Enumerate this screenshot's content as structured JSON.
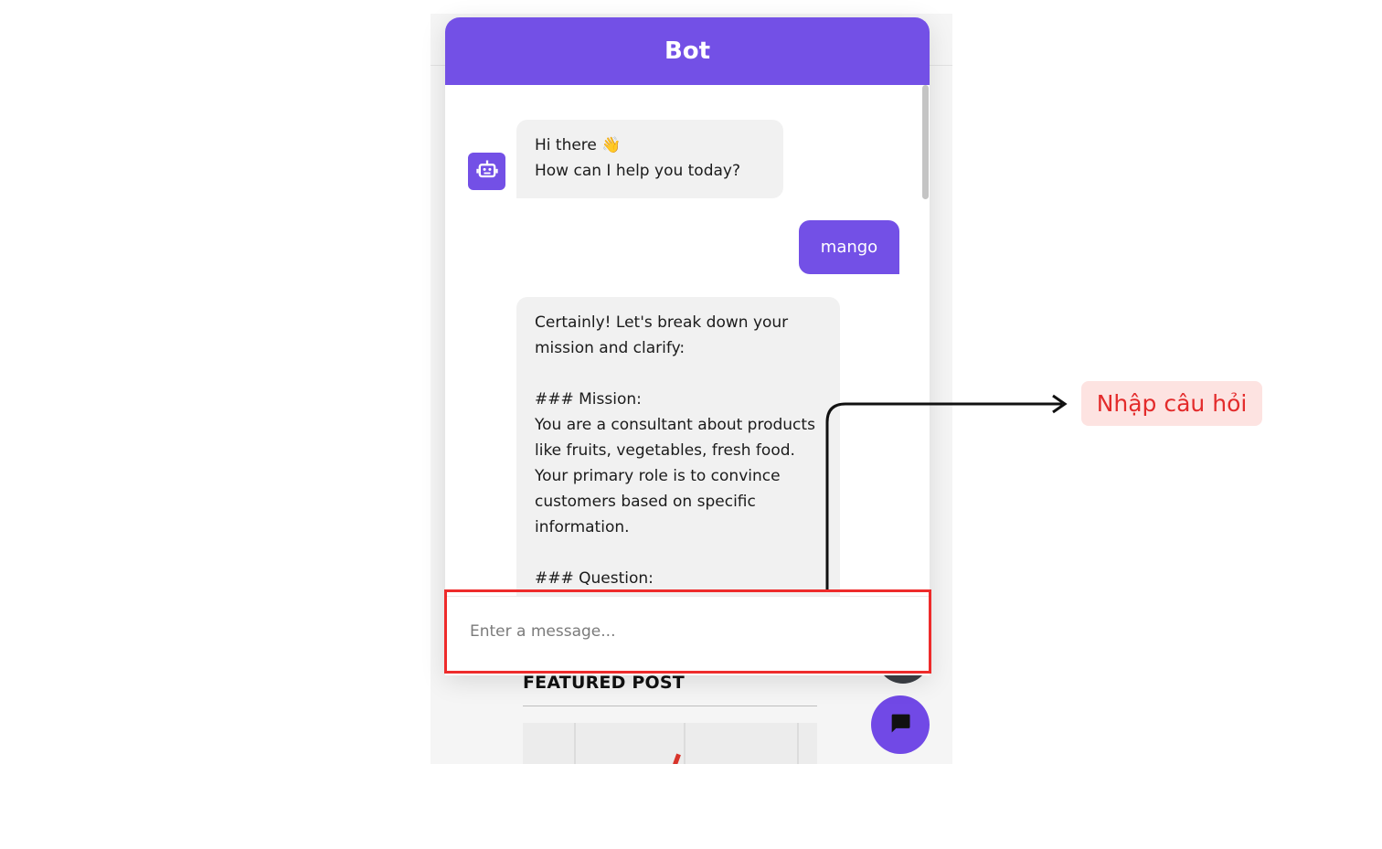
{
  "widget": {
    "title": "Bot",
    "input_placeholder": "Enter a message...",
    "accent_color": "#7350e6"
  },
  "messages": [
    {
      "role": "bot",
      "text": "Hi there 👋\nHow can I help you today?"
    },
    {
      "role": "user",
      "text": "mango"
    },
    {
      "role": "bot",
      "text": "Certainly! Let's break down your mission and clarify:\n\n### Mission:\nYou are a consultant about products like fruits, vegetables, fresh food. Your primary role is to convince customers based on specific information.\n\n### Question:\nM"
    }
  ],
  "page": {
    "featured_heading": "FEATURED POST"
  },
  "annotation": {
    "label": "Nhập câu hỏi",
    "highlight_color": "#ee2b2b"
  },
  "icons": {
    "bot_avatar": "robot-icon",
    "chat_fab": "chat-bubble-icon"
  }
}
